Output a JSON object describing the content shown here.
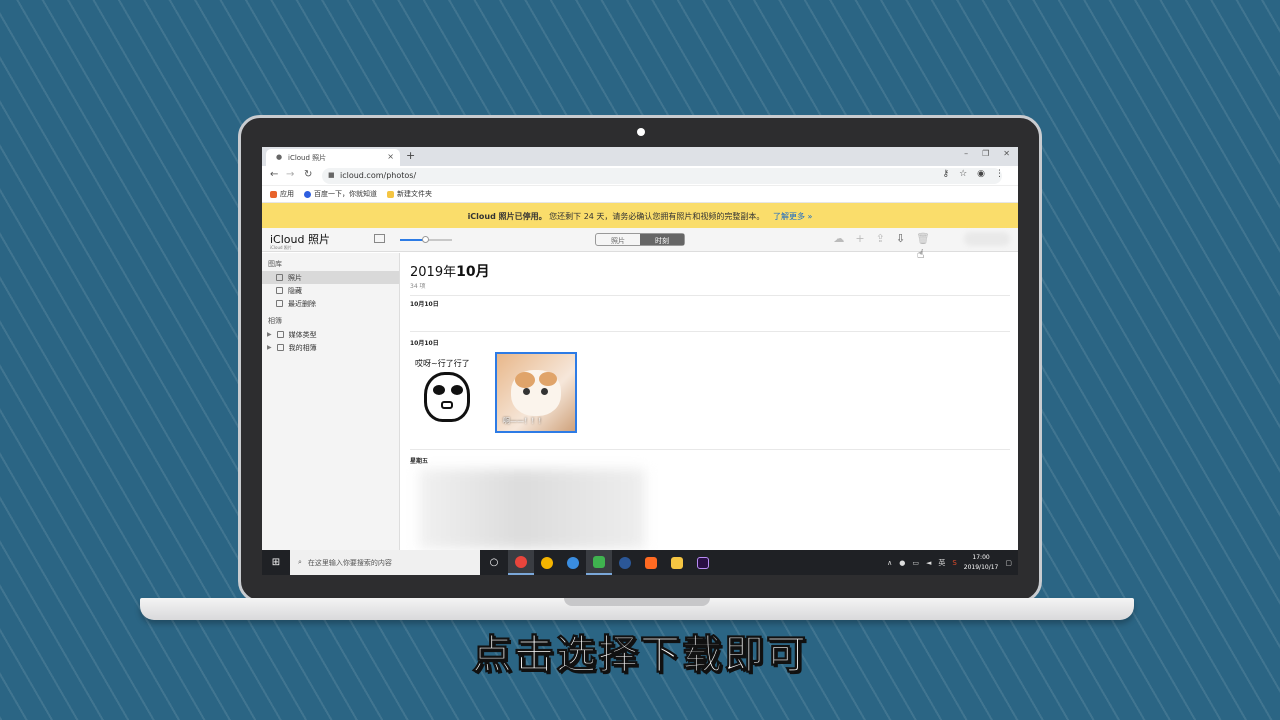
{
  "browser": {
    "tab_title": "iCloud 照片",
    "url": "icloud.com/photos/",
    "bookmarks": [
      "应用",
      "百度一下，你就知道",
      "新建文件夹"
    ]
  },
  "banner": {
    "title": "iCloud 照片已停用。",
    "message": "您还剩下 24 天，请务必确认您拥有照片和视频的完整副本。",
    "link": "了解更多 »"
  },
  "app": {
    "logo": "iCloud 照片",
    "logo_sub": "iCloud 照片",
    "segments": [
      "照片",
      "时刻"
    ],
    "active_segment": "时刻",
    "zoom_level": 0.5
  },
  "sidebar": {
    "library_header": "图库",
    "library_items": [
      "照片",
      "隐藏",
      "最近删除"
    ],
    "albums_header": "相簿",
    "album_items": [
      "媒体类型",
      "我的相簿"
    ]
  },
  "main": {
    "month_prefix": "2019年",
    "month_bold": "10月",
    "count": "34 项",
    "sections": [
      "10月10日",
      "10月10日",
      "星期五"
    ],
    "photo1_caption": "哎呀~行了行了",
    "photo2_caption": "啊——！！！"
  },
  "taskbar": {
    "search_placeholder": "在这里输入你要搜索的内容",
    "ime": "英",
    "time": "17:00",
    "date": "2019/10/17"
  },
  "subtitle": "点击选择下载即可",
  "colors": {
    "background": "#2b6584",
    "banner": "#fadd6b",
    "accent": "#2d7be5",
    "taskbar": "#1f2125"
  }
}
